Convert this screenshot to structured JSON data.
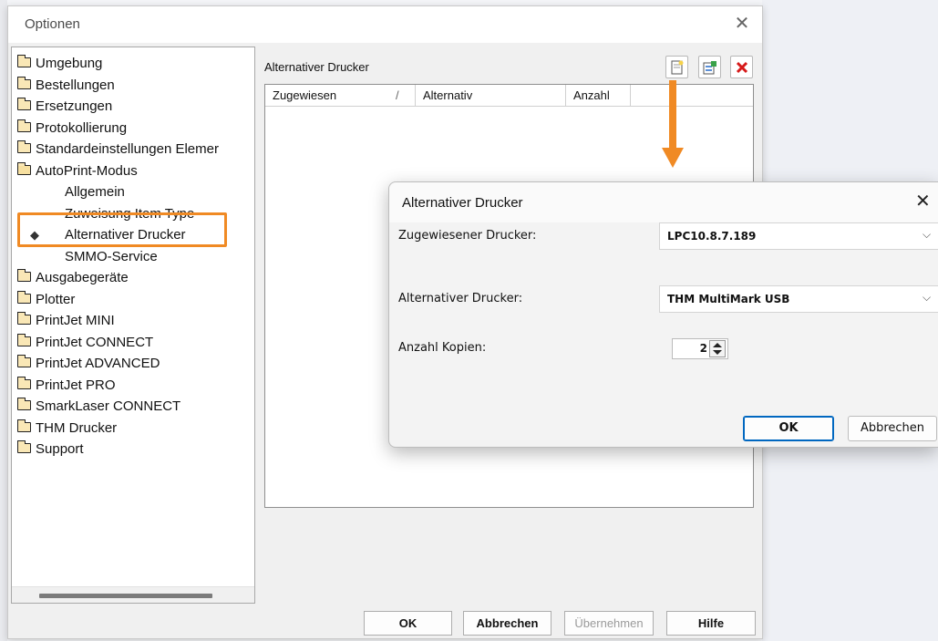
{
  "window": {
    "title": "Optionen",
    "close": "✕"
  },
  "tree": {
    "items": [
      {
        "label": "Umgebung",
        "type": "folder"
      },
      {
        "label": "Bestellungen",
        "type": "folder"
      },
      {
        "label": "Ersetzungen",
        "type": "folder"
      },
      {
        "label": "Protokollierung",
        "type": "folder"
      },
      {
        "label": "Standardeinstellungen Elemer",
        "type": "folder"
      },
      {
        "label": "AutoPrint-Modus",
        "type": "folder-open"
      },
      {
        "label": "Allgemein",
        "type": "child"
      },
      {
        "label": "Zuweisung Item Type",
        "type": "child"
      },
      {
        "label": "Alternativer Drucker",
        "type": "child-selected"
      },
      {
        "label": "SMMO-Service",
        "type": "child"
      },
      {
        "label": "Ausgabegeräte",
        "type": "folder"
      },
      {
        "label": "Plotter",
        "type": "folder"
      },
      {
        "label": "PrintJet MINI",
        "type": "folder"
      },
      {
        "label": "PrintJet CONNECT",
        "type": "folder"
      },
      {
        "label": "PrintJet ADVANCED",
        "type": "folder"
      },
      {
        "label": "PrintJet PRO",
        "type": "folder"
      },
      {
        "label": "SmarkLaser CONNECT",
        "type": "folder"
      },
      {
        "label": "THM Drucker",
        "type": "folder"
      },
      {
        "label": "Support",
        "type": "folder"
      }
    ],
    "bullet": "◆"
  },
  "panel": {
    "label": "Alternativer Drucker",
    "columns": [
      "Zugewiesen",
      "Alternativ",
      "Anzahl"
    ],
    "sort_mark": "/",
    "toolbar": {
      "new": "new-icon",
      "edit": "edit-icon",
      "delete": "delete-icon"
    }
  },
  "buttons": {
    "ok": "OK",
    "cancel": "Abbrechen",
    "apply": "Übernehmen",
    "help": "Hilfe"
  },
  "dialog": {
    "title": "Alternativer Drucker",
    "close": "✕",
    "assigned_label": "Zugewiesener Drucker:",
    "assigned_value": "LPC10.8.7.189",
    "alternative_label": "Alternativer Drucker:",
    "alternative_value": "THM MultiMark USB",
    "copies_label": "Anzahl Kopien:",
    "copies_value": "2",
    "ok": "OK",
    "cancel": "Abbrechen",
    "chevron": "⌵"
  },
  "colors": {
    "accent_orange": "#f08a24",
    "focus_blue": "#0067c0"
  }
}
